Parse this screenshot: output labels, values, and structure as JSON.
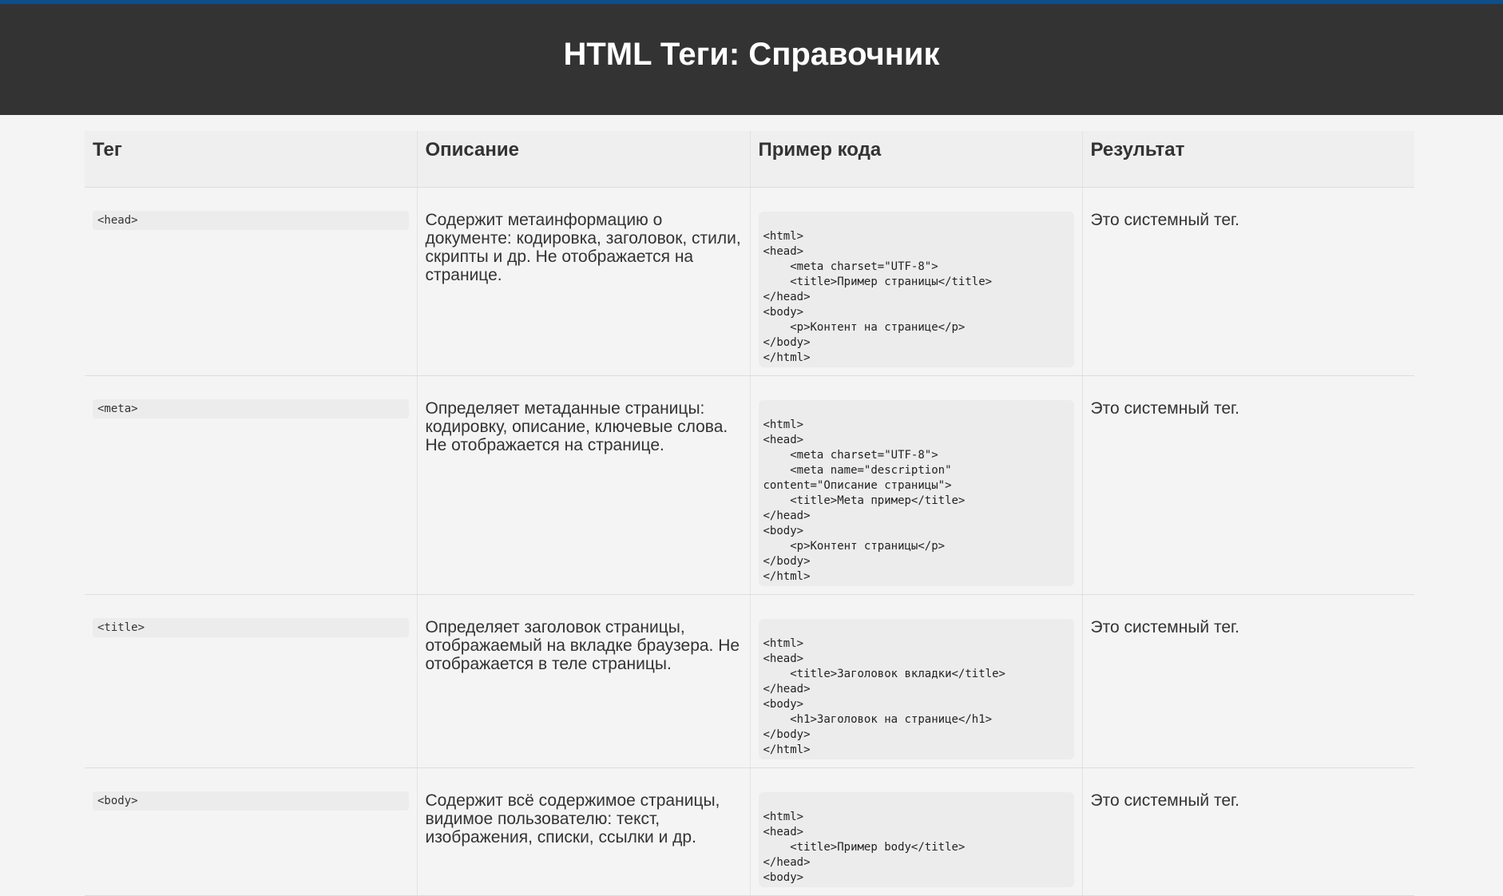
{
  "page_title": "HTML Теги: Справочник",
  "colors": {
    "top_bar": "#0d4f8b",
    "header_bg": "#333333",
    "page_bg": "#f4f4f4",
    "code_bg": "#ececec"
  },
  "table": {
    "headers": {
      "tag": "Тег",
      "description": "Описание",
      "example": "Пример кода",
      "result": "Результат"
    },
    "rows": [
      {
        "tag": "<head>",
        "description": "Содержит метаинформацию о документе: кодировка, заголовок, стили, скрипты и др. Не отображается на странице.",
        "code": "<html>\n<head>\n    <meta charset=\"UTF-8\">\n    <title>Пример страницы</title>\n</head>\n<body>\n    <p>Контент на странице</p>\n</body>\n</html>",
        "result": "Это системный тег."
      },
      {
        "tag": "<meta>",
        "description": "Определяет метаданные страницы: кодировку, описание, ключевые слова. Не отображается на странице.",
        "code": "<html>\n<head>\n    <meta charset=\"UTF-8\">\n    <meta name=\"description\"\ncontent=\"Описание страницы\">\n    <title>Meta пример</title>\n</head>\n<body>\n    <p>Контент страницы</p>\n</body>\n</html>",
        "result": "Это системный тег."
      },
      {
        "tag": "<title>",
        "description": "Определяет заголовок страницы, отображаемый на вкладке браузера. Не отображается в теле страницы.",
        "code": "<html>\n<head>\n    <title>Заголовок вкладки</title>\n</head>\n<body>\n    <h1>Заголовок на странице</h1>\n</body>\n</html>",
        "result": "Это системный тег."
      },
      {
        "tag": "<body>",
        "description": "Содержит всё содержимое страницы, видимое пользователю: текст, изображения, списки, ссылки и др.",
        "code": "<html>\n<head>\n    <title>Пример body</title>\n</head>\n<body>",
        "result": "Это системный тег."
      }
    ]
  }
}
